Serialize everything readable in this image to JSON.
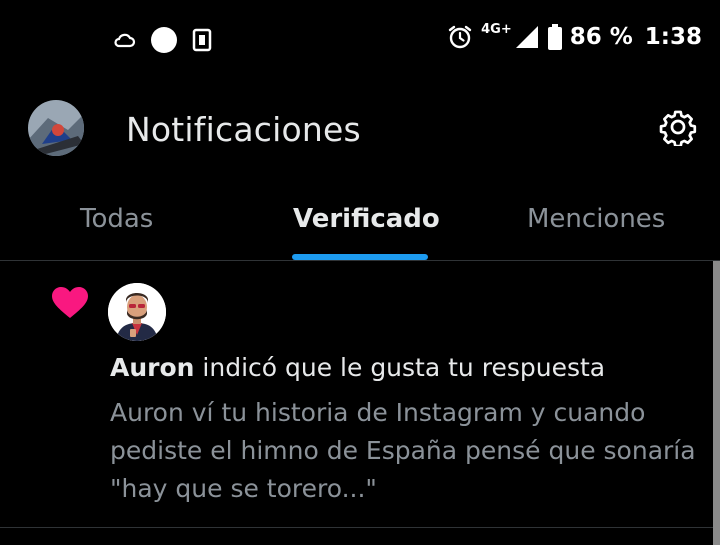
{
  "status_bar": {
    "left_icons": [
      "cloud-icon",
      "circle-notification-icon",
      "sim-card-icon"
    ],
    "right_icons": [
      "alarm-icon",
      "signal-icon",
      "battery-icon"
    ],
    "network": "4G+",
    "battery": "86 %",
    "time": "1:38"
  },
  "header": {
    "title": "Notificaciones",
    "avatar": "profile-avatar",
    "settings_icon": "gear-icon"
  },
  "tabs": [
    {
      "label": "Todas",
      "active": false
    },
    {
      "label": "Verificado",
      "active": true
    },
    {
      "label": "Menciones",
      "active": false
    }
  ],
  "colors": {
    "background": "#000000",
    "text_primary": "#e7e9ea",
    "text_secondary": "#8b9299",
    "accent": "#1d9bf0",
    "like": "#f91880",
    "divider": "#2f3336"
  },
  "notification": {
    "icon": "heart-icon",
    "user": "Auron",
    "action": "indicó que le gusta tu respuesta",
    "body_lines": [
      "Auron ví tu historia de Instagram y cuando",
      "pediste el himno de España pensé que sonaría",
      "\"hay que se torero...\""
    ]
  }
}
